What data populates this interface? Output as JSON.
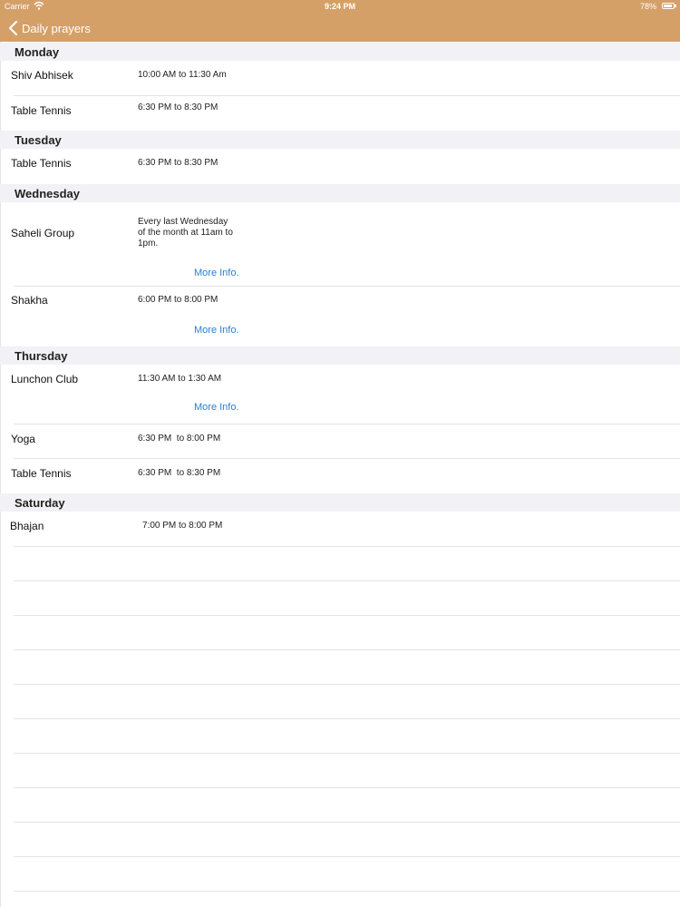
{
  "status_bar": {
    "carrier": "Carrier",
    "time": "9:24 PM",
    "battery": "78%"
  },
  "nav": {
    "back_label": "Daily prayers"
  },
  "colors": {
    "header_bg": "#d4a068",
    "link": "#2a7fd4",
    "section_bg": "#f2f2f6"
  },
  "sections": [
    {
      "day": "Monday",
      "rows": [
        {
          "name": "Shiv Abhisek",
          "time": "10:00 AM to 11:30 Am"
        },
        {
          "name": "Table Tennis",
          "time": "6:30 PM to 8:30 PM"
        }
      ]
    },
    {
      "day": "Tuesday",
      "rows": [
        {
          "name": "Table Tennis",
          "time": "6:30 PM to 8:30 PM"
        }
      ]
    },
    {
      "day": "Wednesday",
      "rows": [
        {
          "name": "Saheli Group",
          "time_lines": [
            "Every last Wednesday",
            "of the month at 11am to",
            "1pm."
          ],
          "more": "More Info."
        },
        {
          "name": "Shakha",
          "time": "6:00 PM to 8:00 PM",
          "more": "More Info."
        }
      ]
    },
    {
      "day": "Thursday",
      "rows": [
        {
          "name": "Lunchon Club",
          "time": "11:30 AM to 1:30 AM",
          "more": "More Info."
        },
        {
          "name": "Yoga",
          "time": "6:30 PM  to 8:00 PM"
        },
        {
          "name": "Table Tennis",
          "time": "6:30 PM  to 8:30 PM"
        }
      ]
    },
    {
      "day": "Saturday",
      "rows": [
        {
          "name": "Bhajan",
          "time": "7:00 PM to 8:00 PM"
        }
      ]
    }
  ]
}
